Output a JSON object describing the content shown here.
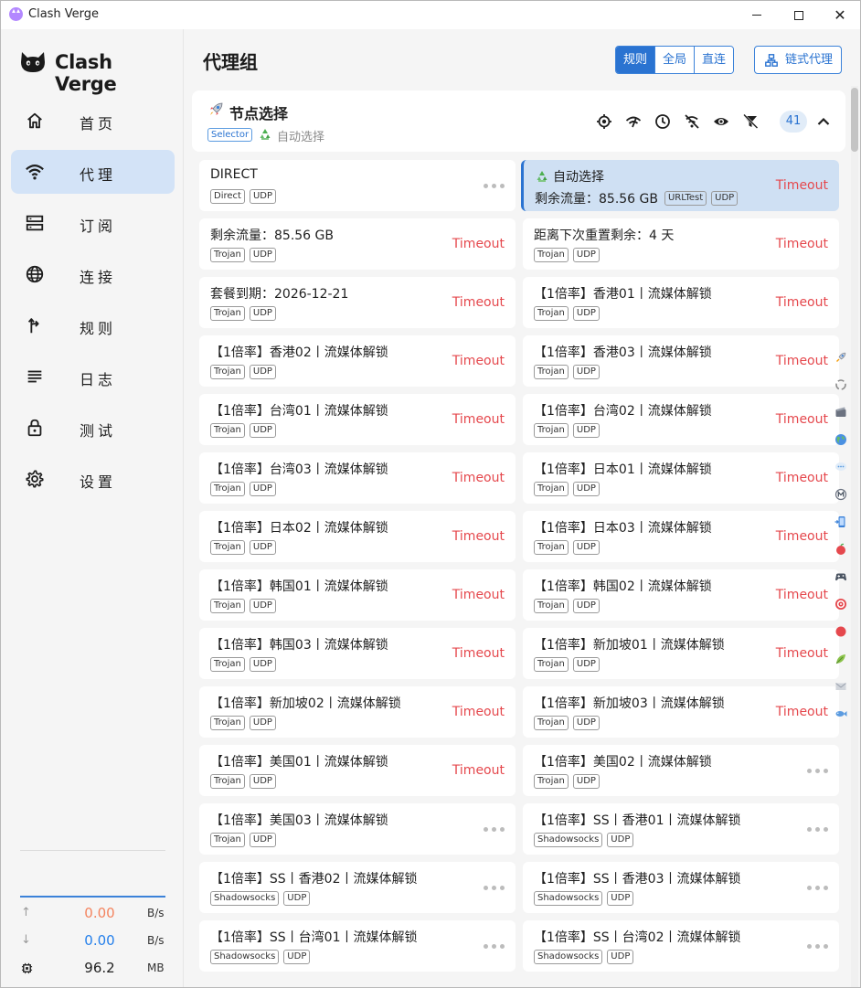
{
  "window": {
    "title": "Clash Verge"
  },
  "sidebar": {
    "logo_text": "Clash Verge",
    "items": [
      {
        "label": "首页",
        "icon": "home-icon"
      },
      {
        "label": "代理",
        "icon": "wifi-icon",
        "active": true
      },
      {
        "label": "订阅",
        "icon": "server-icon"
      },
      {
        "label": "连接",
        "icon": "globe-icon"
      },
      {
        "label": "规则",
        "icon": "fork-icon"
      },
      {
        "label": "日志",
        "icon": "lines-icon"
      },
      {
        "label": "测试",
        "icon": "lock-icon"
      },
      {
        "label": "设置",
        "icon": "gear-icon"
      }
    ],
    "traffic": {
      "up_value": "0.00",
      "up_unit": "B/s",
      "down_value": "0.00",
      "down_unit": "B/s",
      "mem_value": "96.2",
      "mem_unit": "MB"
    }
  },
  "header": {
    "title": "代理组",
    "modes": [
      "规则",
      "全局",
      "直连"
    ],
    "active_mode": "规则",
    "chain_label": "链式代理"
  },
  "group": {
    "name": "节点选择",
    "type": "Selector",
    "now": "自动选择",
    "count": "41"
  },
  "proxies": [
    {
      "name": "DIRECT",
      "tags": [
        "Direct",
        "UDP"
      ],
      "delay": ""
    },
    {
      "name": "自动选择",
      "tags": [
        "URLTest",
        "UDP"
      ],
      "delay": "Timeout",
      "selected": true,
      "subtitle": "剩余流量：85.56 GB"
    },
    {
      "name": "剩余流量：85.56 GB",
      "tags": [
        "Trojan",
        "UDP"
      ],
      "delay": "Timeout"
    },
    {
      "name": "距离下次重置剩余：4 天",
      "tags": [
        "Trojan",
        "UDP"
      ],
      "delay": "Timeout"
    },
    {
      "name": "套餐到期：2026-12-21",
      "tags": [
        "Trojan",
        "UDP"
      ],
      "delay": "Timeout"
    },
    {
      "name": "【1倍率】香港01丨流媒体解锁",
      "tags": [
        "Trojan",
        "UDP"
      ],
      "delay": "Timeout"
    },
    {
      "name": "【1倍率】香港02丨流媒体解锁",
      "tags": [
        "Trojan",
        "UDP"
      ],
      "delay": "Timeout"
    },
    {
      "name": "【1倍率】香港03丨流媒体解锁",
      "tags": [
        "Trojan",
        "UDP"
      ],
      "delay": "Timeout"
    },
    {
      "name": "【1倍率】台湾01丨流媒体解锁",
      "tags": [
        "Trojan",
        "UDP"
      ],
      "delay": "Timeout"
    },
    {
      "name": "【1倍率】台湾02丨流媒体解锁",
      "tags": [
        "Trojan",
        "UDP"
      ],
      "delay": "Timeout"
    },
    {
      "name": "【1倍率】台湾03丨流媒体解锁",
      "tags": [
        "Trojan",
        "UDP"
      ],
      "delay": "Timeout"
    },
    {
      "name": "【1倍率】日本01丨流媒体解锁",
      "tags": [
        "Trojan",
        "UDP"
      ],
      "delay": "Timeout"
    },
    {
      "name": "【1倍率】日本02丨流媒体解锁",
      "tags": [
        "Trojan",
        "UDP"
      ],
      "delay": "Timeout"
    },
    {
      "name": "【1倍率】日本03丨流媒体解锁",
      "tags": [
        "Trojan",
        "UDP"
      ],
      "delay": "Timeout"
    },
    {
      "name": "【1倍率】韩国01丨流媒体解锁",
      "tags": [
        "Trojan",
        "UDP"
      ],
      "delay": "Timeout"
    },
    {
      "name": "【1倍率】韩国02丨流媒体解锁",
      "tags": [
        "Trojan",
        "UDP"
      ],
      "delay": "Timeout"
    },
    {
      "name": "【1倍率】韩国03丨流媒体解锁",
      "tags": [
        "Trojan",
        "UDP"
      ],
      "delay": "Timeout"
    },
    {
      "name": "【1倍率】新加坡01丨流媒体解锁",
      "tags": [
        "Trojan",
        "UDP"
      ],
      "delay": "Timeout"
    },
    {
      "name": "【1倍率】新加坡02丨流媒体解锁",
      "tags": [
        "Trojan",
        "UDP"
      ],
      "delay": "Timeout"
    },
    {
      "name": "【1倍率】新加坡03丨流媒体解锁",
      "tags": [
        "Trojan",
        "UDP"
      ],
      "delay": "Timeout"
    },
    {
      "name": "【1倍率】美国01丨流媒体解锁",
      "tags": [
        "Trojan",
        "UDP"
      ],
      "delay": "Timeout"
    },
    {
      "name": "【1倍率】美国02丨流媒体解锁",
      "tags": [
        "Trojan",
        "UDP"
      ],
      "delay": ""
    },
    {
      "name": "【1倍率】美国03丨流媒体解锁",
      "tags": [
        "Trojan",
        "UDP"
      ],
      "delay": ""
    },
    {
      "name": "【1倍率】SS丨香港01丨流媒体解锁",
      "tags": [
        "Shadowsocks",
        "UDP"
      ],
      "delay": ""
    },
    {
      "name": "【1倍率】SS丨香港02丨流媒体解锁",
      "tags": [
        "Shadowsocks",
        "UDP"
      ],
      "delay": ""
    },
    {
      "name": "【1倍率】SS丨香港03丨流媒体解锁",
      "tags": [
        "Shadowsocks",
        "UDP"
      ],
      "delay": ""
    },
    {
      "name": "【1倍率】SS丨台湾01丨流媒体解锁",
      "tags": [
        "Shadowsocks",
        "UDP"
      ],
      "delay": ""
    },
    {
      "name": "【1倍率】SS丨台湾02丨流媒体解锁",
      "tags": [
        "Shadowsocks",
        "UDP"
      ],
      "delay": ""
    }
  ],
  "colors": {
    "accent": "#2a73d1",
    "timeout": "#e5484d",
    "selected_bg": "#cfe0f3",
    "upload": "#f4845f",
    "download": "#2680eb"
  }
}
